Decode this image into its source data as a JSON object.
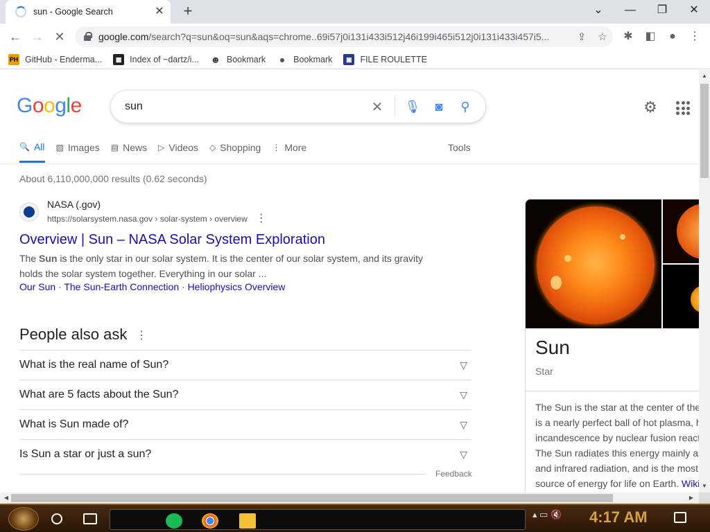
{
  "browser": {
    "tab_title": "sun - Google Search",
    "tab_close": "✕",
    "new_tab": "+",
    "window_controls": {
      "tab_search": "⌄",
      "minimize": "—",
      "maximize": "❐",
      "close": "✕"
    },
    "nav": {
      "back": "←",
      "forward": "→",
      "stop": "✕"
    },
    "url_host": "google.com",
    "url_rest": "/search?q=sun&oq=sun&aqs=chrome..69i57j0i131i433i512j46i199i465i512j0i131i433i457i5...",
    "omnibox_icons": [
      "share-icon",
      "star-icon"
    ],
    "toolbar_icons": [
      "extensions-icon",
      "side-panel-icon",
      "profile-icon",
      "menu-icon"
    ]
  },
  "bookmarks": [
    {
      "icon": "PH",
      "icon_color": "#e6a100",
      "label": "GitHub - Enderma..."
    },
    {
      "icon": "▦",
      "icon_color": "#222222",
      "label": "Index of ~dartz/i..."
    },
    {
      "icon": "☻",
      "icon_color": "#444444",
      "label": "Bookmark"
    },
    {
      "icon": "●",
      "icon_color": "#555555",
      "label": "Bookmark"
    },
    {
      "icon": "▣",
      "icon_color": "#2a3a8a",
      "label": "FILE ROULETTE"
    }
  ],
  "google": {
    "logo": [
      "G",
      "o",
      "o",
      "g",
      "l",
      "e"
    ],
    "logo_colors": [
      "#4285f4",
      "#ea4335",
      "#fbbc05",
      "#4285f4",
      "#34a853",
      "#ea4335"
    ],
    "query": "sun",
    "tabs": [
      {
        "label": "All",
        "icon": "🔍",
        "active": true
      },
      {
        "label": "Images",
        "icon": "▨"
      },
      {
        "label": "News",
        "icon": "▤"
      },
      {
        "label": "Videos",
        "icon": "▷"
      },
      {
        "label": "Shopping",
        "icon": "◇"
      },
      {
        "label": "More",
        "icon": "⋮"
      }
    ],
    "tools": "Tools",
    "stats": "About 6,110,000,000 results (0.62 seconds)"
  },
  "result": {
    "site_name": "NASA (.gov)",
    "site_url": "https://solarsystem.nasa.gov › solar-system › overview",
    "title": "Overview | Sun – NASA Solar System Exploration",
    "snippet_pre": "The ",
    "snippet_bold": "Sun",
    "snippet_post": " is the only star in our solar system. It is the center of our solar system, and its gravity holds the solar system together. Everything in our solar ...",
    "sitelinks": [
      "Our Sun",
      "The Sun-Earth Connection",
      "Heliophysics Overview"
    ]
  },
  "paa": {
    "title": "People also ask",
    "questions": [
      "What is the real name of Sun?",
      "What are 5 facts about the Sun?",
      "What is Sun made of?",
      "Is Sun a star or just a sun?"
    ],
    "feedback": "Feedback"
  },
  "knowledge_panel": {
    "name": "Sun",
    "type": "Star",
    "description_lines": [
      "The Sun is the star at the center of the",
      "is a nearly perfect ball of hot plasma, h",
      "incandescence by nuclear fusion react",
      "The Sun radiates this energy mainly as",
      "and infrared radiation, and is the most",
      "source of energy for life on Earth."
    ],
    "wiki_link": "Wiki"
  },
  "taskbar": {
    "clock": "4:17 AM"
  }
}
